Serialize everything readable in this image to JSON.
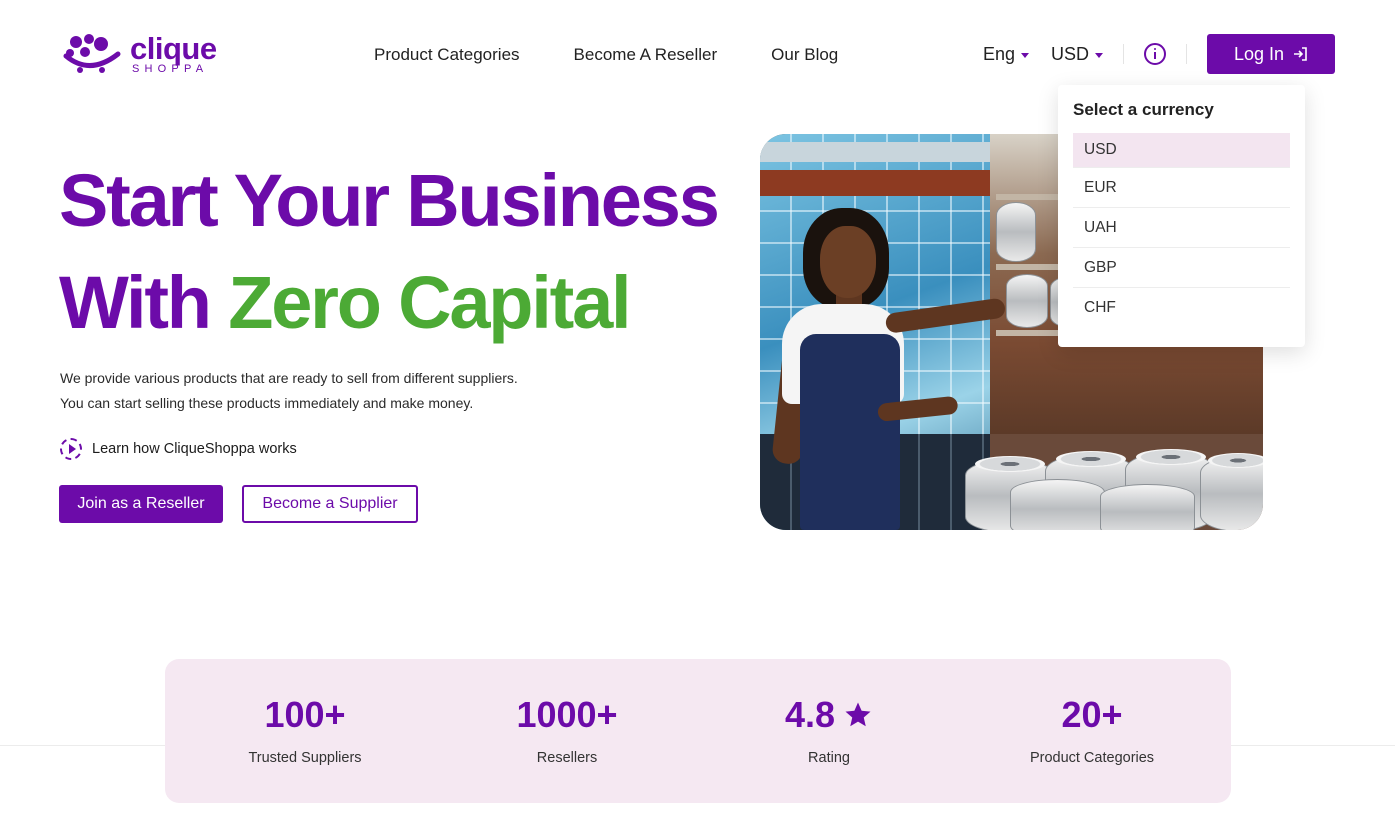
{
  "brand": {
    "name": "clique",
    "tagline": "SHOPPA"
  },
  "nav": {
    "items": [
      "Product Categories",
      "Become A Reseller",
      "Our Blog"
    ]
  },
  "header": {
    "language": "Eng",
    "currency": "USD",
    "login_label": "Log In"
  },
  "currency_dropdown": {
    "title": "Select a currency",
    "options": [
      "USD",
      "EUR",
      "UAH",
      "GBP",
      "CHF"
    ],
    "selected": "USD"
  },
  "hero": {
    "title_line1": "Start Your Business",
    "title_line2_prefix": "With",
    "title_line2_highlight": "Zero Capital",
    "desc_line1": "We provide various products that are ready to sell from different suppliers.",
    "desc_line2": "You can start selling these products immediately and make money.",
    "learn_link": "Learn how CliqueShoppa works",
    "primary_button": "Join as a Reseller",
    "secondary_button": "Become a Supplier"
  },
  "stats": [
    {
      "value": "100+",
      "label": "Trusted Suppliers"
    },
    {
      "value": "1000+",
      "label": "Resellers"
    },
    {
      "value": "4.8",
      "label": "Rating",
      "icon": "star-icon"
    },
    {
      "value": "20+",
      "label": "Product Categories"
    }
  ],
  "colors": {
    "brand_purple": "#6c0ba9",
    "accent_green": "#4caa35",
    "stats_bg": "#f5e8f2"
  }
}
